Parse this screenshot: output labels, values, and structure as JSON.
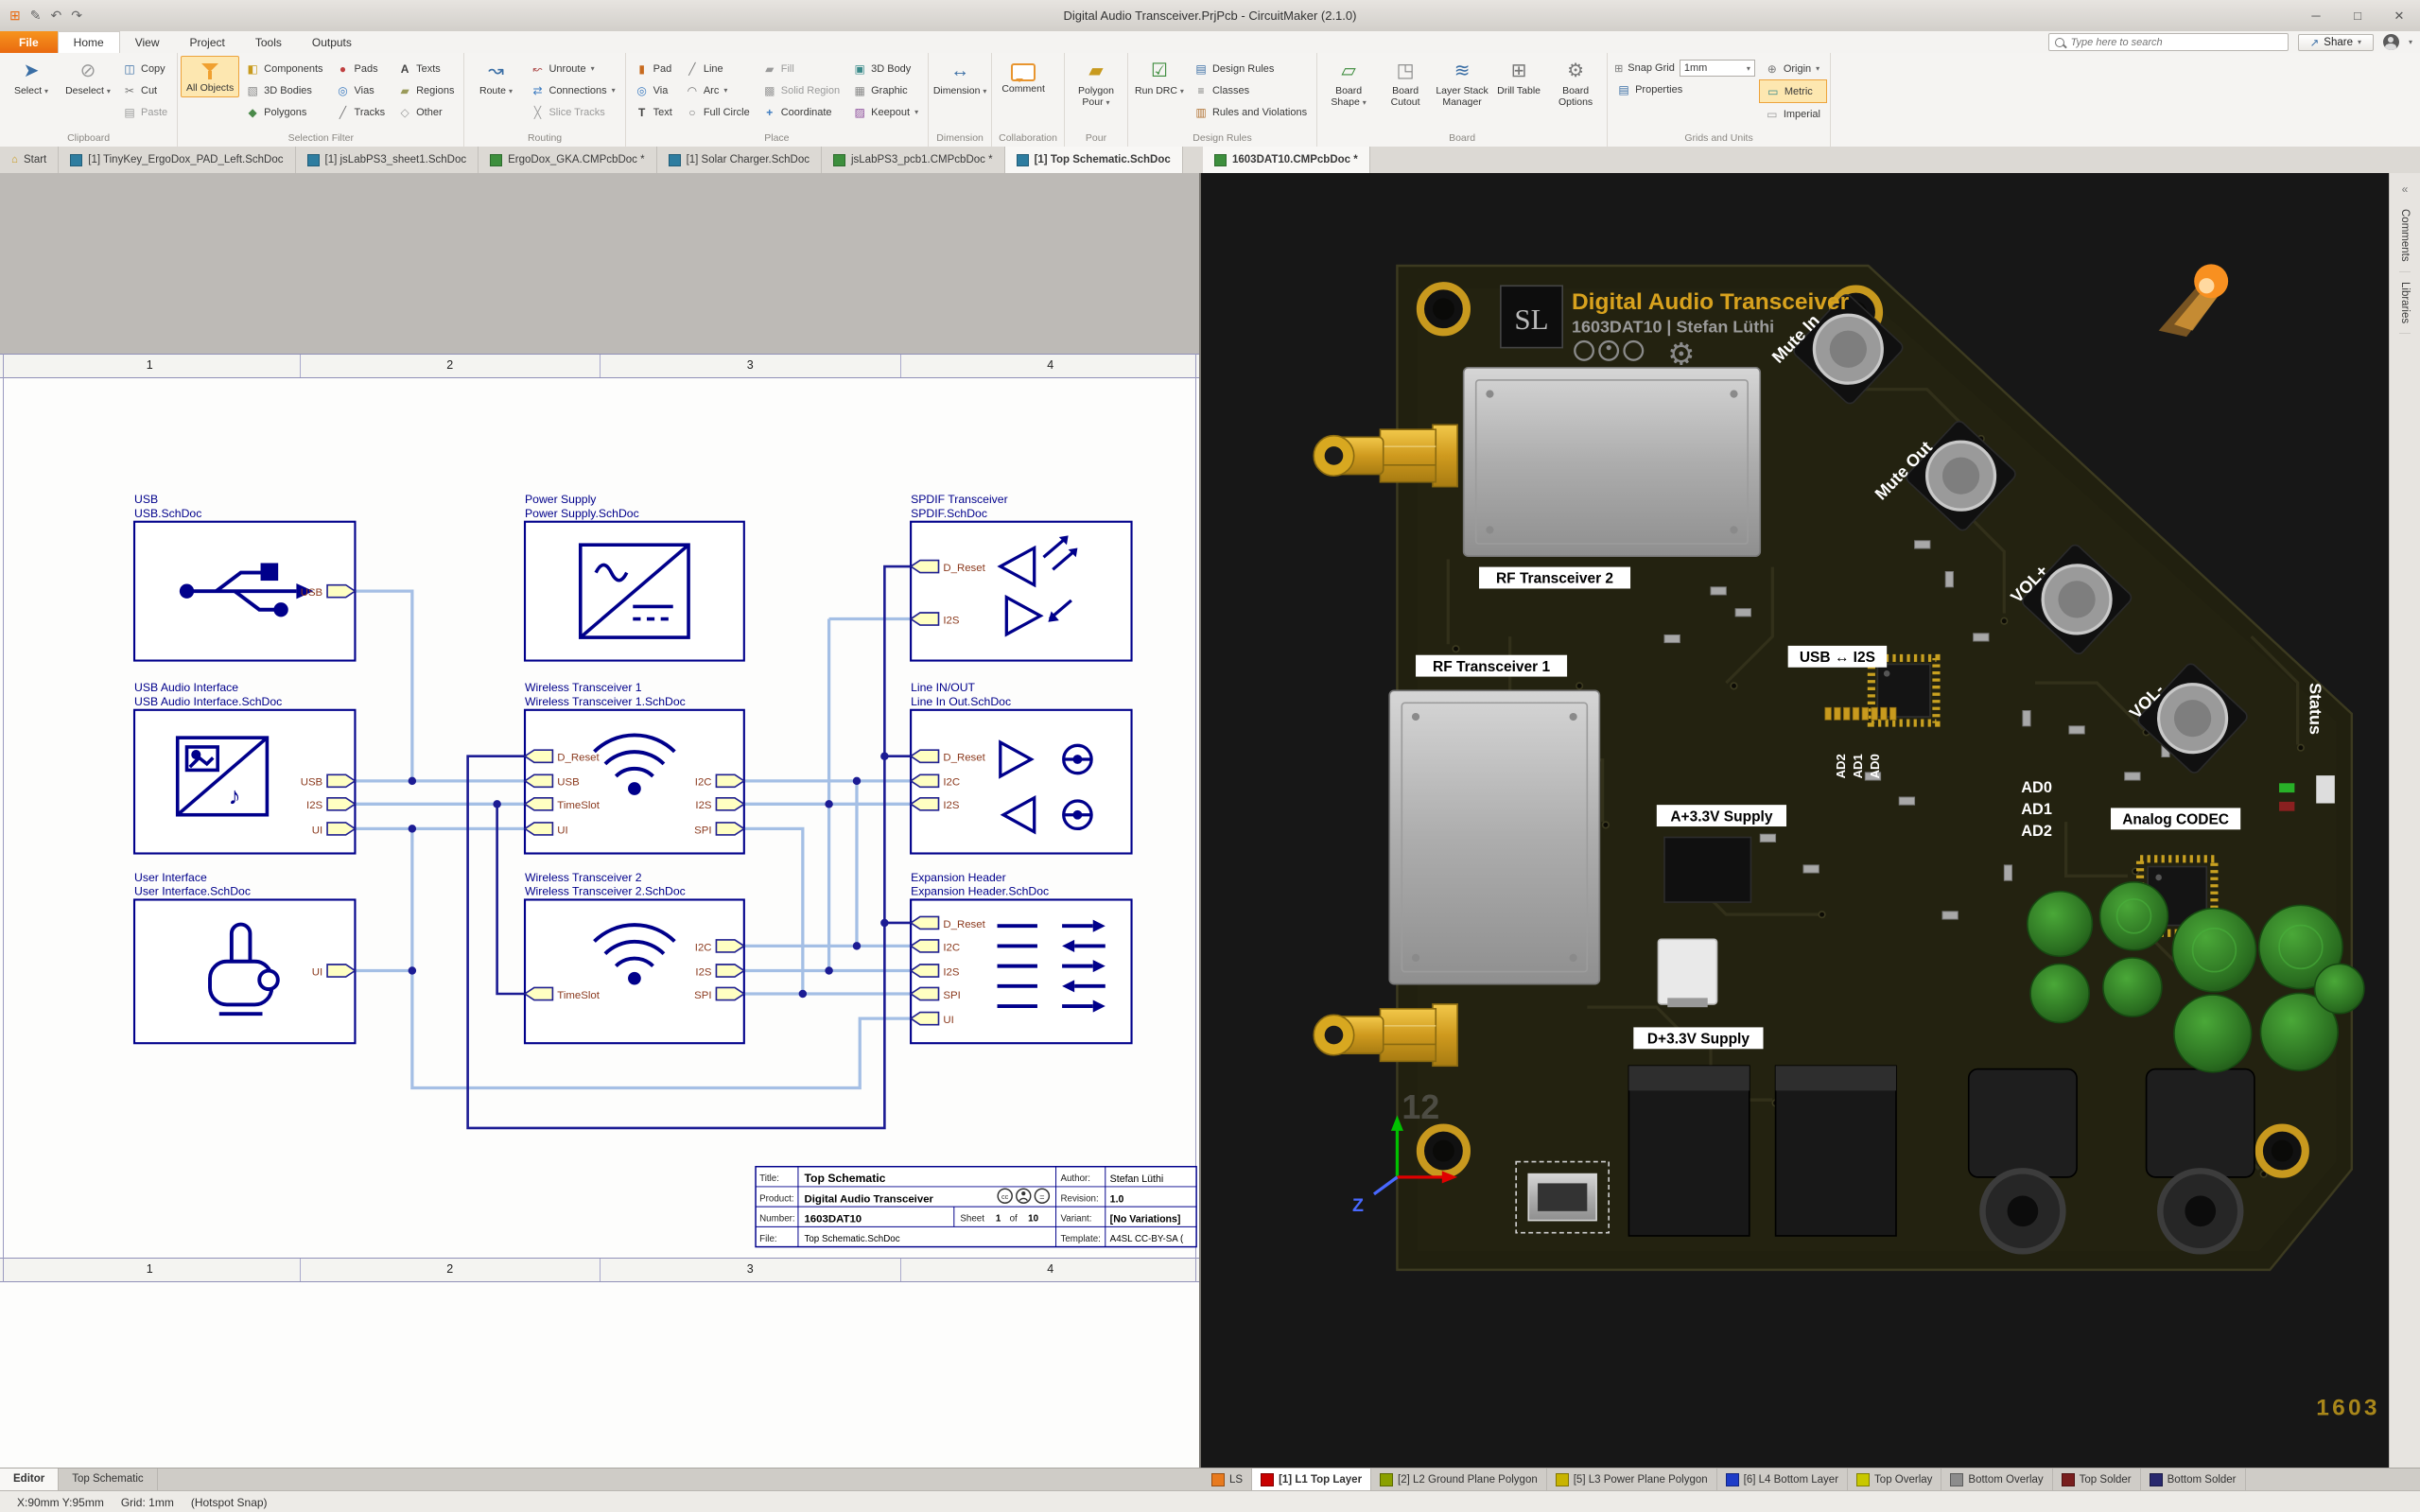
{
  "window": {
    "title": "Digital Audio Transceiver.PrjPcb - CircuitMaker (2.1.0)"
  },
  "menubar": {
    "file": "File",
    "tabs": [
      "Home",
      "View",
      "Project",
      "Tools",
      "Outputs"
    ],
    "active_tab": "Home",
    "search_placeholder": "Type here to search",
    "share": "Share"
  },
  "ribbon": {
    "clipboard": {
      "label": "Clipboard",
      "select": "Select",
      "deselect": "Deselect",
      "copy": "Copy",
      "cut": "Cut",
      "paste": "Paste"
    },
    "selection_filter": {
      "label": "Selection Filter",
      "all_objects": "All Objects",
      "col1": [
        "Components",
        "3D Bodies",
        "Polygons"
      ],
      "col2": [
        "Pads",
        "Vias",
        "Tracks"
      ],
      "col3": [
        "Texts",
        "Regions",
        "Other"
      ]
    },
    "routing": {
      "label": "Routing",
      "route": "Route",
      "unroute": "Unroute",
      "connections": "Connections",
      "slice_tracks": "Slice Tracks"
    },
    "place": {
      "label": "Place",
      "col1": [
        "Pad",
        "Via",
        "Text"
      ],
      "col2": [
        "Line",
        "Arc",
        "Full Circle"
      ],
      "col3": [
        "Fill",
        "Solid Region",
        "Coordinate"
      ],
      "col4": [
        "3D Body",
        "Graphic",
        "Keepout"
      ]
    },
    "dimension": {
      "label": "Dimension",
      "dimension": "Dimension"
    },
    "collaboration": {
      "label": "Collaboration",
      "comment": "Comment"
    },
    "pour": {
      "label": "Pour",
      "polygon_pour": "Polygon Pour"
    },
    "design_rules": {
      "label": "Design Rules",
      "run_drc": "Run DRC",
      "items": [
        "Design Rules",
        "Classes",
        "Rules and Violations"
      ]
    },
    "board": {
      "label": "Board",
      "items": [
        "Board Shape",
        "Board Cutout",
        "Layer Stack Manager",
        "Drill Table",
        "Board Options"
      ]
    },
    "grids": {
      "label": "Grids and Units",
      "snap_grid": "Snap Grid",
      "snap_value": "1mm",
      "properties": "Properties",
      "origin": "Origin",
      "metric": "Metric",
      "imperial": "Imperial"
    }
  },
  "doc_tabs": [
    {
      "label": "Start"
    },
    {
      "label": "[1] TinyKey_ErgoDox_PAD_Left.SchDoc"
    },
    {
      "label": "[1] jsLabPS3_sheet1.SchDoc"
    },
    {
      "label": "ErgoDox_GKA.CMPcbDoc *"
    },
    {
      "label": "[1] Solar Charger.SchDoc"
    },
    {
      "label": "jsLabPS3_pcb1.CMPcbDoc *"
    },
    {
      "label": "[1] Top Schematic.SchDoc"
    }
  ],
  "pcb_doc_tab": {
    "label": "1603DAT10.CMPcbDoc *"
  },
  "ruler": {
    "cols": [
      "1",
      "2",
      "3",
      "4"
    ]
  },
  "schematic": {
    "blocks": {
      "usb": {
        "title": "USB",
        "file": "USB.SchDoc",
        "ports_right": [
          "USB"
        ]
      },
      "power": {
        "title": "Power Supply",
        "file": "Power Supply.SchDoc"
      },
      "spdif": {
        "title": "SPDIF Transceiver",
        "file": "SPDIF.SchDoc",
        "ports_left": [
          "D_Reset",
          "I2S"
        ]
      },
      "uai": {
        "title": "USB Audio Interface",
        "file": "USB Audio Interface.SchDoc",
        "ports_right": [
          "USB",
          "I2S",
          "UI"
        ]
      },
      "wt1": {
        "title": "Wireless Transceiver 1",
        "file": "Wireless Transceiver 1.SchDoc",
        "ports_left": [
          "D_Reset",
          "USB",
          "TimeSlot",
          "UI"
        ],
        "ports_right": [
          "I2C",
          "I2S",
          "SPI"
        ]
      },
      "lineio": {
        "title": "Line IN/OUT",
        "file": "Line In Out.SchDoc",
        "ports_left": [
          "D_Reset",
          "I2C",
          "I2S"
        ]
      },
      "ui": {
        "title": "User Interface",
        "file": "User Interface.SchDoc",
        "ports_right": [
          "UI"
        ]
      },
      "wt2": {
        "title": "Wireless Transceiver 2",
        "file": "Wireless Transceiver 2.SchDoc",
        "ports_left": [
          "TimeSlot"
        ],
        "ports_right": [
          "I2C",
          "I2S",
          "SPI"
        ]
      },
      "exp": {
        "title": "Expansion Header",
        "file": "Expansion Header.SchDoc",
        "ports_left": [
          "D_Reset",
          "I2C",
          "I2S",
          "SPI",
          "UI"
        ]
      }
    },
    "title_block": {
      "title_label": "Title:",
      "title": "Top Schematic",
      "product_label": "Product:",
      "product": "Digital Audio Transceiver",
      "number_label": "Number:",
      "number": "1603DAT10",
      "file_label": "File:",
      "file": "Top Schematic.SchDoc",
      "author_label": "Author:",
      "author": "Stefan Lüthi",
      "revision_label": "Revision:",
      "revision": "1.0",
      "sheet_label": "Sheet",
      "sheet_no": "1",
      "of_label": "of",
      "sheet_total": "10",
      "variant_label": "Variant:",
      "variant": "[No Variations]",
      "template_label": "Template:",
      "template": "A4SL CC-BY-SA ("
    }
  },
  "pcb": {
    "logo": "SL",
    "title": "Digital Audio Transceiver",
    "subtitle": "1603DAT10 | Stefan Lüthi",
    "labels": {
      "rf1": "RF Transceiver 1",
      "rf2": "RF Transceiver 2",
      "usb_i2s": "USB ↔ I2S",
      "a_supply": "A+3.3V Supply",
      "d_supply": "D+3.3V Supply",
      "codec": "Analog CODEC"
    },
    "ad_horizontal": [
      "AD0",
      "AD1",
      "AD2"
    ],
    "ad_rotated": [
      "AD2",
      "AD1",
      "AD0"
    ],
    "button_labels": [
      "Mute In",
      "Mute Out",
      "VOL+",
      "VOL-"
    ],
    "status_label": "Status",
    "axis_label": "Z",
    "watermark": "1603",
    "silk_number": "12"
  },
  "layer_tabs": [
    {
      "label": "LS",
      "color": "#e87a1e"
    },
    {
      "label": "[1] L1 Top Layer",
      "color": "#c80000"
    },
    {
      "label": "[2] L2 Ground Plane Polygon",
      "color": "#8aa000"
    },
    {
      "label": "[5] L3 Power Plane Polygon",
      "color": "#c8b400"
    },
    {
      "label": "[6] L4 Bottom Layer",
      "color": "#1e3cc8"
    },
    {
      "label": "Top Overlay",
      "color": "#c8c800"
    },
    {
      "label": "Bottom Overlay",
      "color": "#8c8c8c"
    },
    {
      "label": "Top Solder",
      "color": "#781e1e"
    },
    {
      "label": "Bottom Solder",
      "color": "#28286e"
    }
  ],
  "editor_tabs": [
    "Editor",
    "Top Schematic"
  ],
  "status_bar": {
    "coords": "X:90mm Y:95mm",
    "grid": "Grid: 1mm",
    "snap": "(Hotspot Snap)"
  },
  "right_strip": [
    "Comments",
    "Libraries"
  ],
  "colors": {
    "file_button": "#ef7b17",
    "ribbon_highlight": "#fde7b0",
    "schematic_navy": "#00008b",
    "port_fill": "#ffffc2",
    "port_label": "#8b3a1e",
    "wire_light": "#a0bce4",
    "wire_dark": "#1c1c94",
    "board_dark": "#21200f",
    "gold": "#d8a21e",
    "shield_gray": "#b9b9b9",
    "cap_green": "#2f7d2a"
  }
}
